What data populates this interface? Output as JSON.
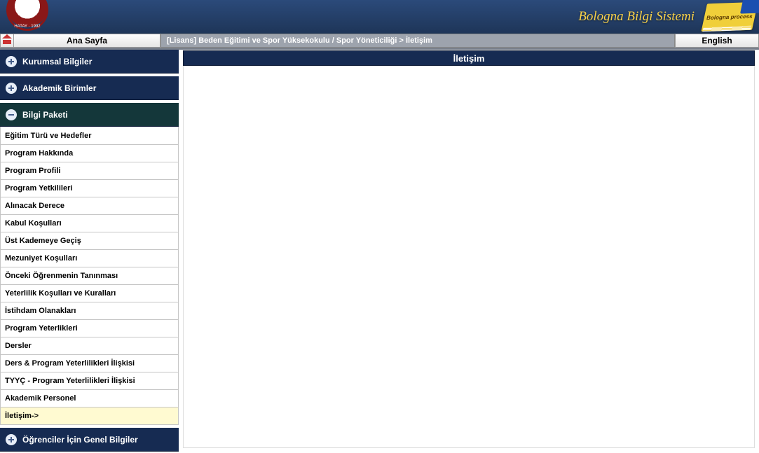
{
  "header": {
    "seal_label": "HATAY · 1992",
    "system_title": "Bologna Bilgi Sistemi",
    "bologna_label": "Bologna process"
  },
  "topbar": {
    "home_label": "Ana Sayfa",
    "breadcrumb": "[Lisans] Beden Eğitimi ve Spor Yüksekokulu / Spor Yöneticiliği > İletişim",
    "lang_label": "English"
  },
  "sidebar": {
    "groups": [
      {
        "label": "Kurumsal Bilgiler",
        "expanded": false
      },
      {
        "label": "Akademik Birimler",
        "expanded": false
      },
      {
        "label": "Bilgi Paketi",
        "expanded": true,
        "items": [
          "Eğitim Türü ve Hedefler",
          "Program Hakkında",
          "Program Profili",
          "Program Yetkilileri",
          "Alınacak Derece",
          "Kabul Koşulları",
          "Üst Kademeye Geçiş",
          "Mezuniyet Koşulları",
          "Önceki Öğrenmenin Tanınması",
          "Yeterlilik Koşulları ve Kuralları",
          "İstihdam Olanakları",
          "Program Yeterlikleri",
          "Dersler",
          "Ders & Program Yeterlilikleri İlişkisi",
          "TYYÇ - Program Yeterlilikleri İlişkisi",
          "Akademik Personel",
          "İletişim->"
        ],
        "active_index": 16
      },
      {
        "label": "Öğrenciler İçin Genel Bilgiler",
        "expanded": false
      }
    ]
  },
  "content": {
    "title": "İletişim"
  }
}
